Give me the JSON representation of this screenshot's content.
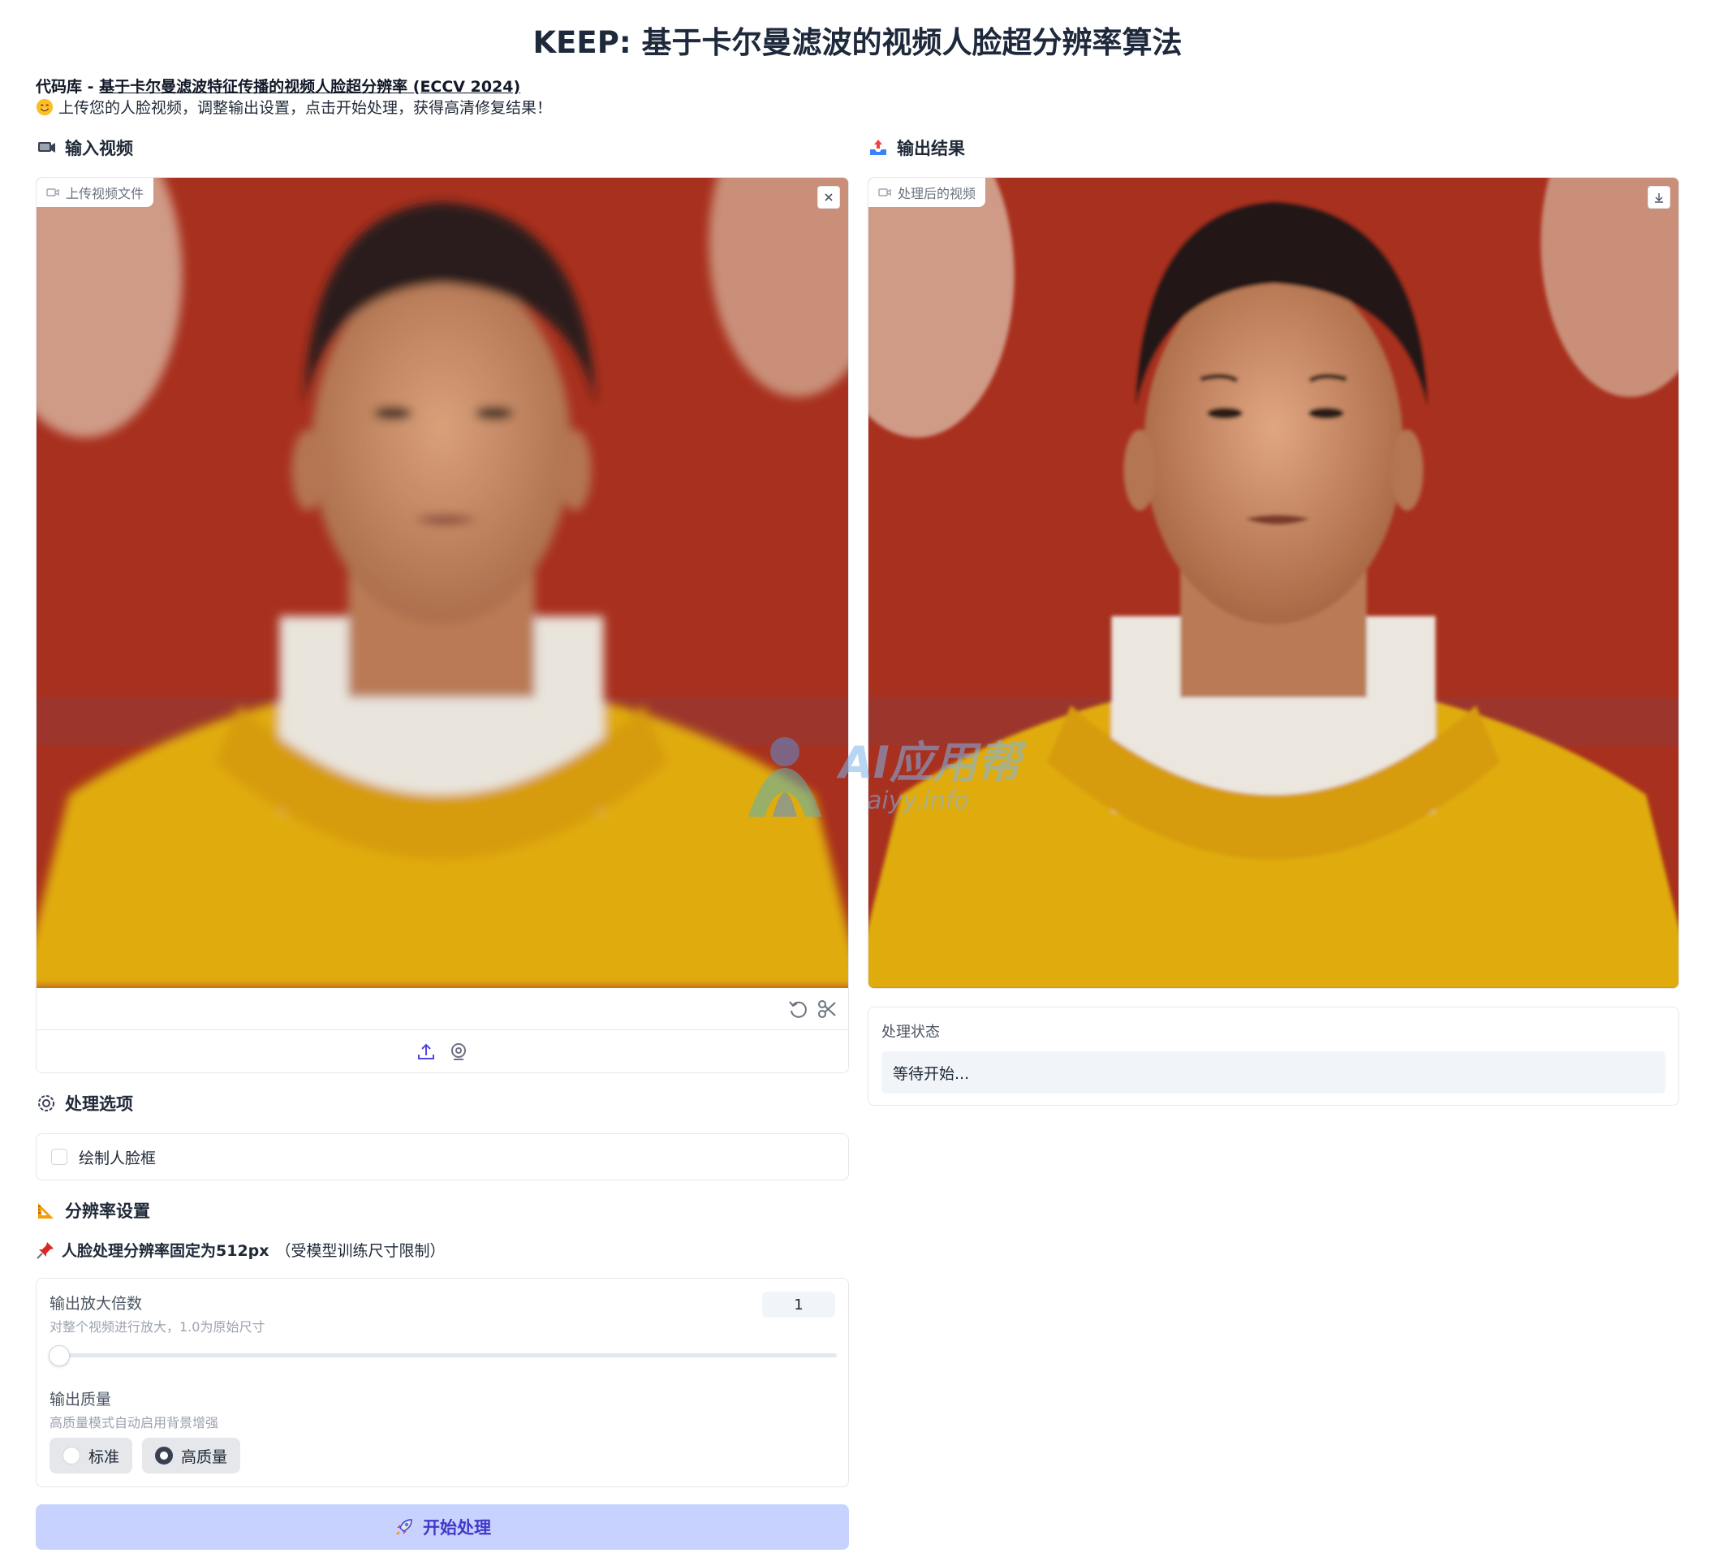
{
  "header": {
    "title": "KEEP: 基于卡尔曼滤波的视频人脸超分辨率算法",
    "subtitle_prefix": "代码库",
    "subtitle_sep": " - ",
    "subtitle_link": "基于卡尔曼滤波特征传播的视频人脸超分辨率 (ECCV 2024)",
    "description": "上传您的人脸视频，调整输出设置，点击开始处理，获得高清修复结果！"
  },
  "input": {
    "heading": "输入视频",
    "chip_label": "上传视频文件",
    "close_icon": "close-icon",
    "controls": [
      "undo-icon",
      "scissors-icon"
    ],
    "sources": [
      "upload-icon",
      "webcam-icon"
    ]
  },
  "output": {
    "heading": "输出结果",
    "chip_label": "处理后的视频",
    "download_icon": "download-icon",
    "status_label": "处理状态",
    "status_value": "等待开始..."
  },
  "options": {
    "heading": "处理选项",
    "draw_box_label": "绘制人脸框",
    "draw_box_checked": false
  },
  "resolution": {
    "heading": "分辨率设置",
    "note_bold": "人脸处理分辨率固定为512px",
    "note_rest": "（受模型训练尺寸限制）",
    "scale_label": "输出放大倍数",
    "scale_info": "对整个视频进行放大，1.0为原始尺寸",
    "scale_value": "1",
    "scale_fraction": 0,
    "quality_label": "输出质量",
    "quality_info": "高质量模式自动启用背景增强",
    "quality_options": [
      "标准",
      "高质量"
    ],
    "quality_selected": "高质量"
  },
  "actions": {
    "start_label": "开始处理"
  },
  "watermark": {
    "brand": "AI应用帮",
    "site": "aiyy.info"
  },
  "colors": {
    "accent": "#4338ca",
    "button_bg": "#c7d2fe",
    "sweater": "#e0ac0c",
    "background_red": "#a8301e"
  }
}
